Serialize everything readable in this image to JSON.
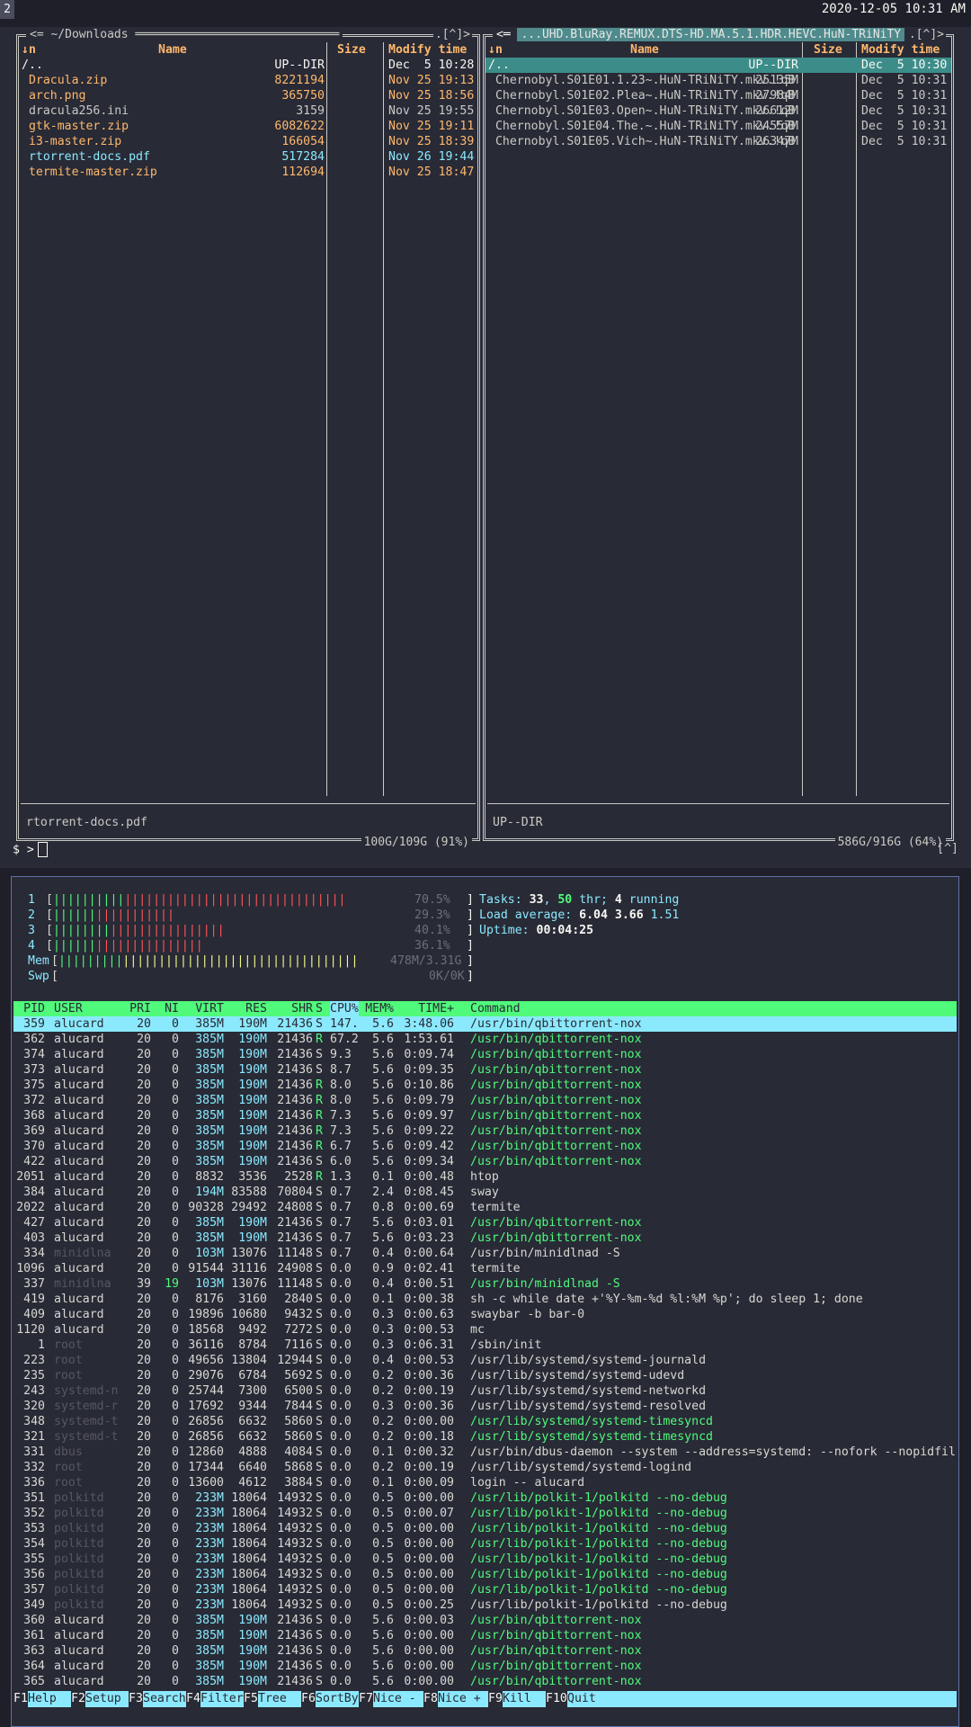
{
  "topbar": {
    "workspace": "2",
    "clock": "2020-12-05 10:31 AM"
  },
  "mc": {
    "left": {
      "title": "~/Downloads",
      "corner": "[^]",
      "columns": {
        "sort": "↓n",
        "name": "Name",
        "size": "Size",
        "mtime": "Modify time"
      },
      "rows": [
        {
          "name": "/..",
          "size": "UP--DIR",
          "date": "Dec  5 10:28",
          "color": "#f8f8f2"
        },
        {
          "name": " Dracula.zip",
          "size": "8221194",
          "date": "Nov 25 19:13",
          "color": "#ffb86c"
        },
        {
          "name": " arch.png",
          "size": "365750",
          "date": "Nov 25 18:56",
          "color": "#ffb86c"
        },
        {
          "name": " dracula256.ini",
          "size": "3159",
          "date": "Nov 25 19:55",
          "color": "#c9cac4"
        },
        {
          "name": " gtk-master.zip",
          "size": "6082622",
          "date": "Nov 25 19:11",
          "color": "#ffb86c"
        },
        {
          "name": " i3-master.zip",
          "size": "166054",
          "date": "Nov 25 18:39",
          "color": "#ffb86c"
        },
        {
          "name": " rtorrent-docs.pdf",
          "size": "517284",
          "date": "Nov 26 19:44",
          "color": "#8be9fd"
        },
        {
          "name": " termite-master.zip",
          "size": "112694",
          "date": "Nov 25 18:47",
          "color": "#ffb86c"
        }
      ],
      "mini_status": "rtorrent-docs.pdf",
      "free": "100G/109G (91%)"
    },
    "right": {
      "title": "...UHD.BluRay.REMUX.DTS-HD.MA.5.1.HDR.HEVC.HuN-TRiNiTY",
      "corner": "[^]",
      "columns": {
        "sort": "↓n",
        "name": "Name",
        "size": "Size",
        "mtime": "Modify time"
      },
      "rows": [
        {
          "name": "/..",
          "size": "UP--DIR",
          "date": "Dec  5 10:30",
          "selected": true
        },
        {
          "name": " Chernobyl.S01E01.1.23~.HuN-TRiNiTY.mkv.!qB",
          "size": "25135M",
          "date": "Dec  5 10:31"
        },
        {
          "name": " Chernobyl.S01E02.Plea~.HuN-TRiNiTY.mkv.!qB",
          "size": "27984M",
          "date": "Dec  5 10:31"
        },
        {
          "name": " Chernobyl.S01E03.Open~.HuN-TRiNiTY.mkv.!qB",
          "size": "26612M",
          "date": "Dec  5 10:31"
        },
        {
          "name": " Chernobyl.S01E04.The.~.HuN-TRiNiTY.mkv.!qB",
          "size": "24557M",
          "date": "Dec  5 10:31"
        },
        {
          "name": " Chernobyl.S01E05.Vich~.HuN-TRiNiTY.mkv.!qB",
          "size": "26347M",
          "date": "Dec  5 10:31"
        }
      ],
      "mini_status": "UP--DIR",
      "free": "586G/916G (64%)"
    },
    "prompt": "$ >",
    "caret": "[^]"
  },
  "htop": {
    "meters": [
      {
        "label": "1",
        "green": 10,
        "red": 31,
        "value": "70.5%"
      },
      {
        "label": "2",
        "green": 6,
        "red": 11,
        "value": "29.3%"
      },
      {
        "label": "3",
        "green": 8,
        "red": 16,
        "value": "40.1%"
      },
      {
        "label": "4",
        "green": 6,
        "red": 15,
        "value": "36.1%"
      }
    ],
    "mem": {
      "label": "Mem",
      "green": 9,
      "yellow": 33,
      "value": "478M/3.31G"
    },
    "swp": {
      "label": "Swp",
      "value": "0K/0K"
    },
    "tasks": {
      "label": "Tasks: ",
      "count": "33",
      "sep": ", ",
      "thr": "50",
      "thr_label": " thr; ",
      "running": "4",
      "running_label": " running"
    },
    "load": {
      "label": "Load average: ",
      "v1": "6.04",
      "v2": "3.66",
      "v3": "1.51"
    },
    "uptime": {
      "label": "Uptime: ",
      "value": "00:04:25"
    },
    "columns": [
      "PID",
      "USER",
      "PRI",
      "NI",
      "VIRT",
      "RES",
      "SHR",
      "S",
      "CPU%",
      "MEM%",
      "TIME+",
      "Command"
    ],
    "processes": [
      [
        "359",
        "alucard",
        "20",
        "0",
        "385M",
        "190M",
        "21436",
        "S",
        "147.",
        "5.6",
        "3:48.06",
        "/usr/bin/qbittorrent-nox"
      ],
      [
        "362",
        "alucard",
        "20",
        "0",
        "385M",
        "190M",
        "21436",
        "R",
        "67.2",
        "5.6",
        "1:53.61",
        "/usr/bin/qbittorrent-nox"
      ],
      [
        "374",
        "alucard",
        "20",
        "0",
        "385M",
        "190M",
        "21436",
        "S",
        "9.3",
        "5.6",
        "0:09.74",
        "/usr/bin/qbittorrent-nox"
      ],
      [
        "373",
        "alucard",
        "20",
        "0",
        "385M",
        "190M",
        "21436",
        "S",
        "8.7",
        "5.6",
        "0:09.35",
        "/usr/bin/qbittorrent-nox"
      ],
      [
        "375",
        "alucard",
        "20",
        "0",
        "385M",
        "190M",
        "21436",
        "R",
        "8.0",
        "5.6",
        "0:10.86",
        "/usr/bin/qbittorrent-nox"
      ],
      [
        "372",
        "alucard",
        "20",
        "0",
        "385M",
        "190M",
        "21436",
        "R",
        "8.0",
        "5.6",
        "0:09.79",
        "/usr/bin/qbittorrent-nox"
      ],
      [
        "368",
        "alucard",
        "20",
        "0",
        "385M",
        "190M",
        "21436",
        "R",
        "7.3",
        "5.6",
        "0:09.97",
        "/usr/bin/qbittorrent-nox"
      ],
      [
        "369",
        "alucard",
        "20",
        "0",
        "385M",
        "190M",
        "21436",
        "R",
        "7.3",
        "5.6",
        "0:09.22",
        "/usr/bin/qbittorrent-nox"
      ],
      [
        "370",
        "alucard",
        "20",
        "0",
        "385M",
        "190M",
        "21436",
        "R",
        "6.7",
        "5.6",
        "0:09.42",
        "/usr/bin/qbittorrent-nox"
      ],
      [
        "422",
        "alucard",
        "20",
        "0",
        "385M",
        "190M",
        "21436",
        "S",
        "6.0",
        "5.6",
        "0:09.34",
        "/usr/bin/qbittorrent-nox"
      ],
      [
        "2051",
        "alucard",
        "20",
        "0",
        "8832",
        "3536",
        "2528",
        "R",
        "1.3",
        "0.1",
        "0:00.48",
        "htop"
      ],
      [
        "384",
        "alucard",
        "20",
        "0",
        "194M",
        "83588",
        "70804",
        "S",
        "0.7",
        "2.4",
        "0:08.45",
        "sway"
      ],
      [
        "2022",
        "alucard",
        "20",
        "0",
        "90328",
        "29492",
        "24808",
        "S",
        "0.7",
        "0.8",
        "0:00.69",
        "termite"
      ],
      [
        "427",
        "alucard",
        "20",
        "0",
        "385M",
        "190M",
        "21436",
        "S",
        "0.7",
        "5.6",
        "0:03.01",
        "/usr/bin/qbittorrent-nox"
      ],
      [
        "403",
        "alucard",
        "20",
        "0",
        "385M",
        "190M",
        "21436",
        "S",
        "0.7",
        "5.6",
        "0:03.23",
        "/usr/bin/qbittorrent-nox"
      ],
      [
        "334",
        "minidlna",
        "20",
        "0",
        "103M",
        "13076",
        "11148",
        "S",
        "0.7",
        "0.4",
        "0:00.64",
        "/usr/bin/minidlnad -S"
      ],
      [
        "1096",
        "alucard",
        "20",
        "0",
        "91544",
        "31116",
        "24908",
        "S",
        "0.0",
        "0.9",
        "0:02.41",
        "termite"
      ],
      [
        "337",
        "minidlna",
        "39",
        "19",
        "103M",
        "13076",
        "11148",
        "S",
        "0.0",
        "0.4",
        "0:00.51",
        "/usr/bin/minidlnad -S"
      ],
      [
        "419",
        "alucard",
        "20",
        "0",
        "8176",
        "3160",
        "2840",
        "S",
        "0.0",
        "0.1",
        "0:00.38",
        "sh -c while date +'%Y-%m-%d %l:%M %p'; do sleep 1; done"
      ],
      [
        "409",
        "alucard",
        "20",
        "0",
        "19896",
        "10680",
        "9432",
        "S",
        "0.0",
        "0.3",
        "0:00.63",
        "swaybar -b bar-0"
      ],
      [
        "1120",
        "alucard",
        "20",
        "0",
        "18568",
        "9492",
        "7272",
        "S",
        "0.0",
        "0.3",
        "0:00.53",
        "mc"
      ],
      [
        "1",
        "root",
        "20",
        "0",
        "36116",
        "8784",
        "7116",
        "S",
        "0.0",
        "0.3",
        "0:06.31",
        "/sbin/init"
      ],
      [
        "223",
        "root",
        "20",
        "0",
        "49656",
        "13804",
        "12944",
        "S",
        "0.0",
        "0.4",
        "0:00.53",
        "/usr/lib/systemd/systemd-journald"
      ],
      [
        "235",
        "root",
        "20",
        "0",
        "29076",
        "6784",
        "5692",
        "S",
        "0.0",
        "0.2",
        "0:00.36",
        "/usr/lib/systemd/systemd-udevd"
      ],
      [
        "243",
        "systemd-n",
        "20",
        "0",
        "25744",
        "7300",
        "6500",
        "S",
        "0.0",
        "0.2",
        "0:00.19",
        "/usr/lib/systemd/systemd-networkd"
      ],
      [
        "320",
        "systemd-r",
        "20",
        "0",
        "17692",
        "9344",
        "7844",
        "S",
        "0.0",
        "0.3",
        "0:00.36",
        "/usr/lib/systemd/systemd-resolved"
      ],
      [
        "348",
        "systemd-t",
        "20",
        "0",
        "26856",
        "6632",
        "5860",
        "S",
        "0.0",
        "0.2",
        "0:00.00",
        "/usr/lib/systemd/systemd-timesyncd"
      ],
      [
        "321",
        "systemd-t",
        "20",
        "0",
        "26856",
        "6632",
        "5860",
        "S",
        "0.0",
        "0.2",
        "0:00.18",
        "/usr/lib/systemd/systemd-timesyncd"
      ],
      [
        "331",
        "dbus",
        "20",
        "0",
        "12860",
        "4888",
        "4084",
        "S",
        "0.0",
        "0.1",
        "0:00.32",
        "/usr/bin/dbus-daemon --system --address=systemd: --nofork --nopidfil"
      ],
      [
        "332",
        "root",
        "20",
        "0",
        "17344",
        "6640",
        "5868",
        "S",
        "0.0",
        "0.2",
        "0:00.19",
        "/usr/lib/systemd/systemd-logind"
      ],
      [
        "336",
        "root",
        "20",
        "0",
        "13600",
        "4612",
        "3884",
        "S",
        "0.0",
        "0.1",
        "0:00.09",
        "login -- alucard"
      ],
      [
        "351",
        "polkitd",
        "20",
        "0",
        "233M",
        "18064",
        "14932",
        "S",
        "0.0",
        "0.5",
        "0:00.00",
        "/usr/lib/polkit-1/polkitd --no-debug"
      ],
      [
        "352",
        "polkitd",
        "20",
        "0",
        "233M",
        "18064",
        "14932",
        "S",
        "0.0",
        "0.5",
        "0:00.07",
        "/usr/lib/polkit-1/polkitd --no-debug"
      ],
      [
        "353",
        "polkitd",
        "20",
        "0",
        "233M",
        "18064",
        "14932",
        "S",
        "0.0",
        "0.5",
        "0:00.00",
        "/usr/lib/polkit-1/polkitd --no-debug"
      ],
      [
        "354",
        "polkitd",
        "20",
        "0",
        "233M",
        "18064",
        "14932",
        "S",
        "0.0",
        "0.5",
        "0:00.00",
        "/usr/lib/polkit-1/polkitd --no-debug"
      ],
      [
        "355",
        "polkitd",
        "20",
        "0",
        "233M",
        "18064",
        "14932",
        "S",
        "0.0",
        "0.5",
        "0:00.00",
        "/usr/lib/polkit-1/polkitd --no-debug"
      ],
      [
        "356",
        "polkitd",
        "20",
        "0",
        "233M",
        "18064",
        "14932",
        "S",
        "0.0",
        "0.5",
        "0:00.00",
        "/usr/lib/polkit-1/polkitd --no-debug"
      ],
      [
        "357",
        "polkitd",
        "20",
        "0",
        "233M",
        "18064",
        "14932",
        "S",
        "0.0",
        "0.5",
        "0:00.00",
        "/usr/lib/polkit-1/polkitd --no-debug"
      ],
      [
        "349",
        "polkitd",
        "20",
        "0",
        "233M",
        "18064",
        "14932",
        "S",
        "0.0",
        "0.5",
        "0:00.25",
        "/usr/lib/polkit-1/polkitd --no-debug"
      ],
      [
        "360",
        "alucard",
        "20",
        "0",
        "385M",
        "190M",
        "21436",
        "S",
        "0.0",
        "5.6",
        "0:00.03",
        "/usr/bin/qbittorrent-nox"
      ],
      [
        "361",
        "alucard",
        "20",
        "0",
        "385M",
        "190M",
        "21436",
        "S",
        "0.0",
        "5.6",
        "0:00.00",
        "/usr/bin/qbittorrent-nox"
      ],
      [
        "363",
        "alucard",
        "20",
        "0",
        "385M",
        "190M",
        "21436",
        "S",
        "0.0",
        "5.6",
        "0:00.00",
        "/usr/bin/qbittorrent-nox"
      ],
      [
        "364",
        "alucard",
        "20",
        "0",
        "385M",
        "190M",
        "21436",
        "S",
        "0.0",
        "5.6",
        "0:00.00",
        "/usr/bin/qbittorrent-nox"
      ],
      [
        "365",
        "alucard",
        "20",
        "0",
        "385M",
        "190M",
        "21436",
        "S",
        "0.0",
        "5.6",
        "0:00.00",
        "/usr/bin/qbittorrent-nox"
      ]
    ],
    "thread_rows": [
      1,
      2,
      3,
      4,
      5,
      6,
      7,
      8,
      9,
      13,
      14,
      17,
      26,
      27,
      31,
      32,
      33,
      34,
      35,
      36,
      37,
      39,
      40,
      41,
      42,
      43
    ],
    "fkeys": [
      {
        "key": "F1",
        "label": "Help  "
      },
      {
        "key": "F2",
        "label": "Setup "
      },
      {
        "key": "F3",
        "label": "Search"
      },
      {
        "key": "F4",
        "label": "Filter"
      },
      {
        "key": "F5",
        "label": "Tree  "
      },
      {
        "key": "F6",
        "label": "SortBy"
      },
      {
        "key": "F7",
        "label": "Nice - "
      },
      {
        "key": "F8",
        "label": "Nice + "
      },
      {
        "key": "F9",
        "label": "Kill  "
      },
      {
        "key": "F10",
        "label": "Quit"
      }
    ]
  }
}
